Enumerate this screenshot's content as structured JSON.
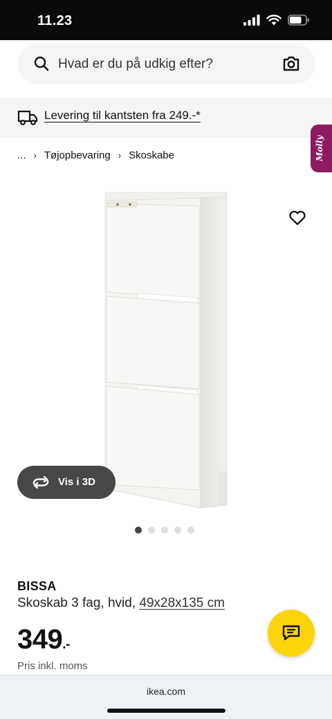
{
  "status_bar": {
    "time": "11.23",
    "battery_level": 0.75
  },
  "search": {
    "placeholder": "Hvad er du på udkig efter?"
  },
  "delivery_banner": {
    "text": "Levering til kantsten fra 249.-*"
  },
  "assistant_tab": {
    "label": "Molly",
    "color": "#8e1a61"
  },
  "breadcrumb": {
    "items": [
      "...",
      "Tøjopbevaring",
      "Skoskabe"
    ]
  },
  "gallery": {
    "view_3d_label": "Vis i 3D",
    "image_count": 5,
    "active_index": 0
  },
  "product": {
    "name": "BISSA",
    "description": "Skoskab 3 fag, hvid,",
    "dimensions": "49x28x135 cm",
    "price": "349",
    "price_suffix": ".-",
    "price_note": "Pris inkl. moms"
  },
  "browser": {
    "url": "ikea.com"
  },
  "colors": {
    "accent_yellow": "#fdd40a",
    "dark_button": "#484848"
  }
}
